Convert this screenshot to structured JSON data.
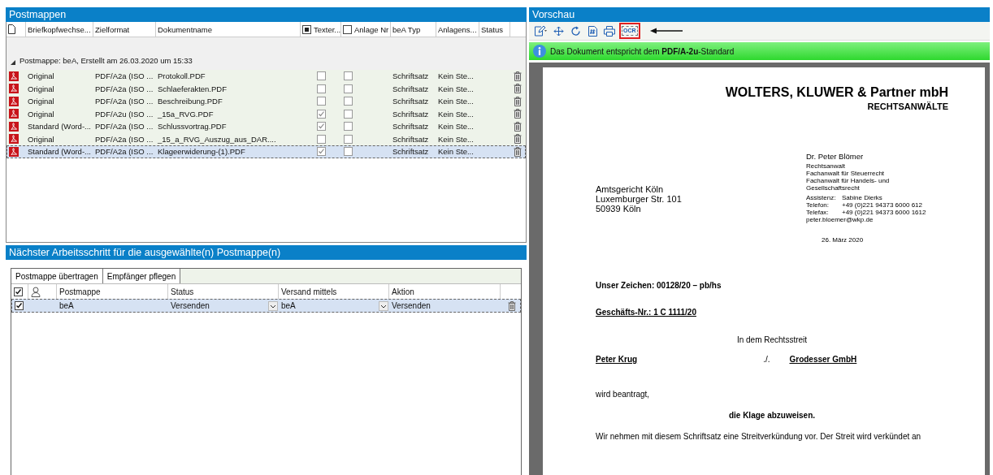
{
  "postmappen": {
    "title": "Postmappen",
    "columns": [
      {
        "kind": "doc-icon"
      },
      {
        "kind": "text",
        "label": "Briefkopfwechse..."
      },
      {
        "kind": "text",
        "label": "Zielformat"
      },
      {
        "kind": "text",
        "label": "Dokumentname"
      },
      {
        "kind": "check",
        "label": "Texter...",
        "indeterminate": true
      },
      {
        "kind": "check",
        "label": "Anlage Nr",
        "checked": false,
        "indeterminate": false
      },
      {
        "kind": "text",
        "label": "beA Typ"
      },
      {
        "kind": "text",
        "label": "Anlagens..."
      },
      {
        "kind": "text",
        "label": "Status"
      }
    ],
    "group": {
      "label": "Postmappe: beA, Erstellt am 26.03.2020 um 15:33",
      "expanded": true
    },
    "rows": [
      {
        "briefkopf": "Original",
        "format": "PDF/A2a (ISO ...",
        "name": "Protokoll.PDF",
        "texterkennung": false,
        "anlage": false,
        "typ": "Schriftsatz",
        "anlagens": "Kein Ste...",
        "selected": false
      },
      {
        "briefkopf": "Original",
        "format": "PDF/A2a (ISO ...",
        "name": "Schlaeferakten.PDF",
        "texterkennung": false,
        "anlage": false,
        "typ": "Schriftsatz",
        "anlagens": "Kein Ste...",
        "selected": false
      },
      {
        "briefkopf": "Original",
        "format": "PDF/A2a (ISO ...",
        "name": "Beschreibung.PDF",
        "texterkennung": false,
        "anlage": false,
        "typ": "Schriftsatz",
        "anlagens": "Kein Ste...",
        "selected": false
      },
      {
        "briefkopf": "Original",
        "format": "PDF/A2u (ISO ...",
        "name": "_15a_RVG.PDF",
        "texterkennung": true,
        "anlage": false,
        "typ": "Schriftsatz",
        "anlagens": "Kein Ste...",
        "selected": false
      },
      {
        "briefkopf": "Standard (Word-...",
        "format": "PDF/A2a (ISO ...",
        "name": "Schlussvortrag.PDF",
        "texterkennung": true,
        "anlage": false,
        "typ": "Schriftsatz",
        "anlagens": "Kein Ste...",
        "selected": false
      },
      {
        "briefkopf": "Original",
        "format": "PDF/A2a (ISO ...",
        "name": "_15_a_RVG_Auszug_aus_DAR....",
        "texterkennung": false,
        "anlage": false,
        "typ": "Schriftsatz",
        "anlagens": "Kein Ste...",
        "selected": false
      },
      {
        "briefkopf": "Standard (Word-...",
        "format": "PDF/A2a (ISO ...",
        "name": "Klageerwiderung-(1).PDF",
        "texterkennung": true,
        "anlage": false,
        "typ": "Schriftsatz",
        "anlagens": "Kein Ste...",
        "selected": true
      }
    ]
  },
  "naechster": {
    "title": "Nächster Arbeitsschritt für die ausgewählte(n) Postmappe(n)",
    "buttons": [
      "Postmappe übertragen",
      "Empfänger pflegen"
    ],
    "header_checked": true,
    "columns": [
      "Postmappe",
      "Status",
      "Versand mittels",
      "Aktion"
    ],
    "rows": [
      {
        "checked": true,
        "selected": true,
        "postmappe": "beA",
        "status": "Versenden",
        "versand": "beA",
        "aktion": "Versenden"
      }
    ]
  },
  "vorschau": {
    "title": "Vorschau",
    "toolbar": [
      {
        "kind": "edit",
        "highlighted": false
      },
      {
        "kind": "move",
        "highlighted": false
      },
      {
        "kind": "rotate",
        "highlighted": false
      },
      {
        "kind": "hash",
        "highlighted": false
      },
      {
        "kind": "print",
        "highlighted": false
      },
      {
        "kind": "ocr",
        "label": "OCR",
        "highlighted": true
      }
    ],
    "info": "Das Dokument entspricht dem **PDF/A-2u**-Standard",
    "document": {
      "firm": "WOLTERS, KLUWER & Partner mbH",
      "firm_sub": "RECHTSANWÄLTE",
      "address": [
        "Amtsgericht Köln",
        "Luxemburger Str. 101",
        "50939  Köln"
      ],
      "contact_name": "Dr. Peter Blömer",
      "contact_lines": [
        "Rechtsanwalt",
        "Fachanwalt für Steuerrecht",
        "Fachanwalt für Handels- und",
        "Gesellschaftsrecht"
      ],
      "contact_table": [
        [
          "Assistenz:",
          "Sabine Dierks"
        ],
        [
          "Telefon:",
          "+49 (0)221 94373 6000 612"
        ],
        [
          "Telefax:",
          "+49 (0)221 94373 6000 1612"
        ]
      ],
      "email": "peter.bloemer@wkp.de",
      "date": "26. März 2020",
      "body": [
        {
          "kind": "bold",
          "text": "Unser Zeichen: 00128/20 – pb/hs"
        },
        {
          "kind": "bold-underline",
          "text": "Geschäfts-Nr.: 1  C 1111/20"
        },
        {
          "kind": "center",
          "text": "In dem Rechtsstreit"
        },
        {
          "kind": "parties",
          "parts": [
            "Peter Krug",
            "./.",
            "Grodesser GmbH"
          ]
        },
        {
          "kind": "plain",
          "text": "wird beantragt,"
        },
        {
          "kind": "bold-center",
          "text": "die Klage abzuweisen."
        },
        {
          "kind": "plain",
          "text": "Wir nehmen mit diesem Schriftsatz eine Streitverkündung vor. Der Streit wird verkündet an"
        }
      ]
    }
  }
}
